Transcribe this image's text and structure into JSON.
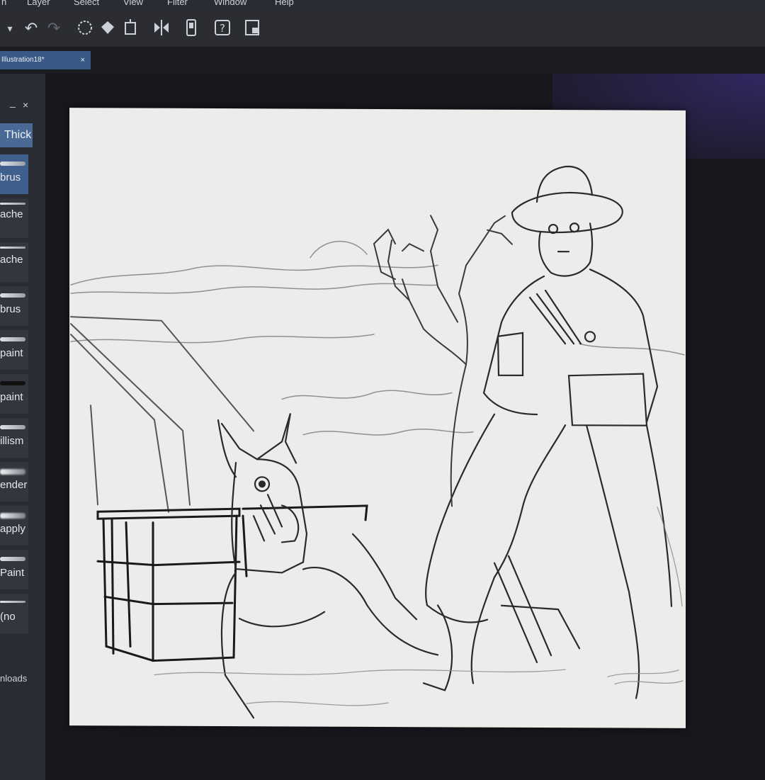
{
  "menu": {
    "items": [
      "n",
      "Layer",
      "Select",
      "View",
      "Filter",
      "Window",
      "Help"
    ]
  },
  "document": {
    "tab_label": "Illustration18*",
    "close": "×"
  },
  "sub_tool_panel": {
    "minimize": "_",
    "close": "×",
    "group_tab": "Thick",
    "brushes": [
      {
        "label": "brus",
        "style": "sel"
      },
      {
        "label": "ache",
        "style": "soft"
      },
      {
        "label": "ache",
        "style": "soft"
      },
      {
        "label": "brus",
        "style": "soft"
      },
      {
        "label": "paint",
        "style": "soft"
      },
      {
        "label": "paint",
        "style": "hard"
      },
      {
        "label": "illism",
        "style": "soft"
      },
      {
        "label": "ender",
        "style": "fuzzy"
      },
      {
        "label": "apply",
        "style": "soft"
      },
      {
        "label": "Paint",
        "style": "soft"
      },
      {
        "label": "(no",
        "style": "soft"
      }
    ],
    "downloads": "nloads"
  },
  "toolbar": {
    "icons": [
      "dropdown-icon",
      "undo-icon",
      "redo-icon",
      "lasso-icon",
      "bucket-icon",
      "crop-icon",
      "flip-icon",
      "device-icon",
      "help-icon",
      "snapshot-icon"
    ]
  },
  "colors": {
    "panel": "#2a2c33",
    "accent": "#4a6a95",
    "canvas": "#ececea"
  }
}
